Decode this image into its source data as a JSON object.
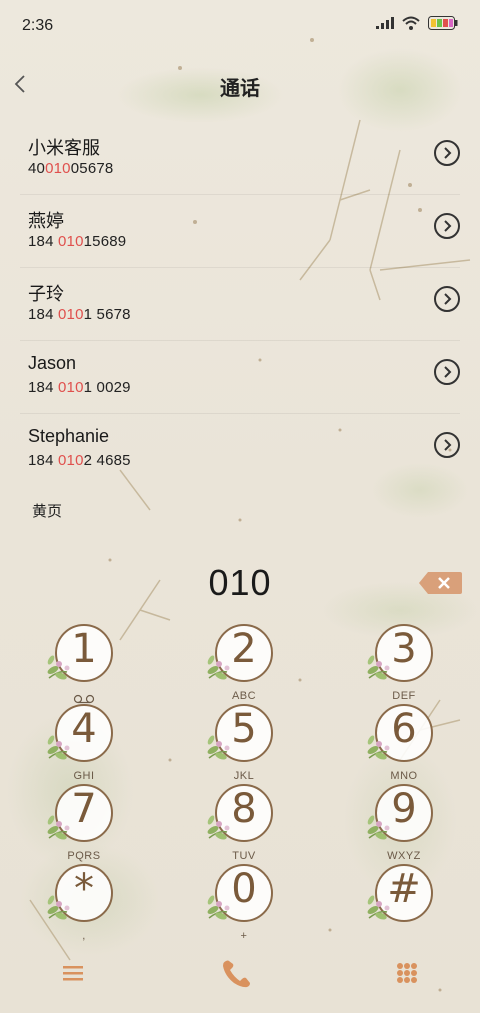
{
  "status_bar": {
    "time": "2:36"
  },
  "header": {
    "title": "通话"
  },
  "results": [
    {
      "name": "小米客服",
      "num_pre": "40",
      "num_hl": "010",
      "num_post": "05678"
    },
    {
      "name": "燕婷",
      "num_pre": "184 ",
      "num_hl": "010",
      "num_post": "15689"
    },
    {
      "name": "子玲",
      "num_pre": "184 ",
      "num_hl": "010",
      "num_post": "1 5678"
    },
    {
      "name": "Jason",
      "num_pre": "184 ",
      "num_hl": "010",
      "num_post": "1 0029"
    },
    {
      "name": "Stephanie",
      "num_pre": "184 ",
      "num_hl": "010",
      "num_post": "2 4685"
    }
  ],
  "yellow_pages": "黄页",
  "dialed_number": "010",
  "keypad": [
    {
      "digit": "1",
      "letters": ""
    },
    {
      "digit": "2",
      "letters": "ABC"
    },
    {
      "digit": "3",
      "letters": "DEF"
    },
    {
      "digit": "4",
      "letters": "GHI"
    },
    {
      "digit": "5",
      "letters": "JKL"
    },
    {
      "digit": "6",
      "letters": "MNO"
    },
    {
      "digit": "7",
      "letters": "PQRS"
    },
    {
      "digit": "8",
      "letters": "TUV"
    },
    {
      "digit": "9",
      "letters": "WXYZ"
    },
    {
      "digit": "*",
      "letters": ","
    },
    {
      "digit": "0",
      "letters": "+"
    },
    {
      "digit": "#",
      "letters": ""
    }
  ],
  "colors": {
    "accent": "#d9925e",
    "highlight": "#e0504d",
    "key_text": "#7a5a3a"
  }
}
